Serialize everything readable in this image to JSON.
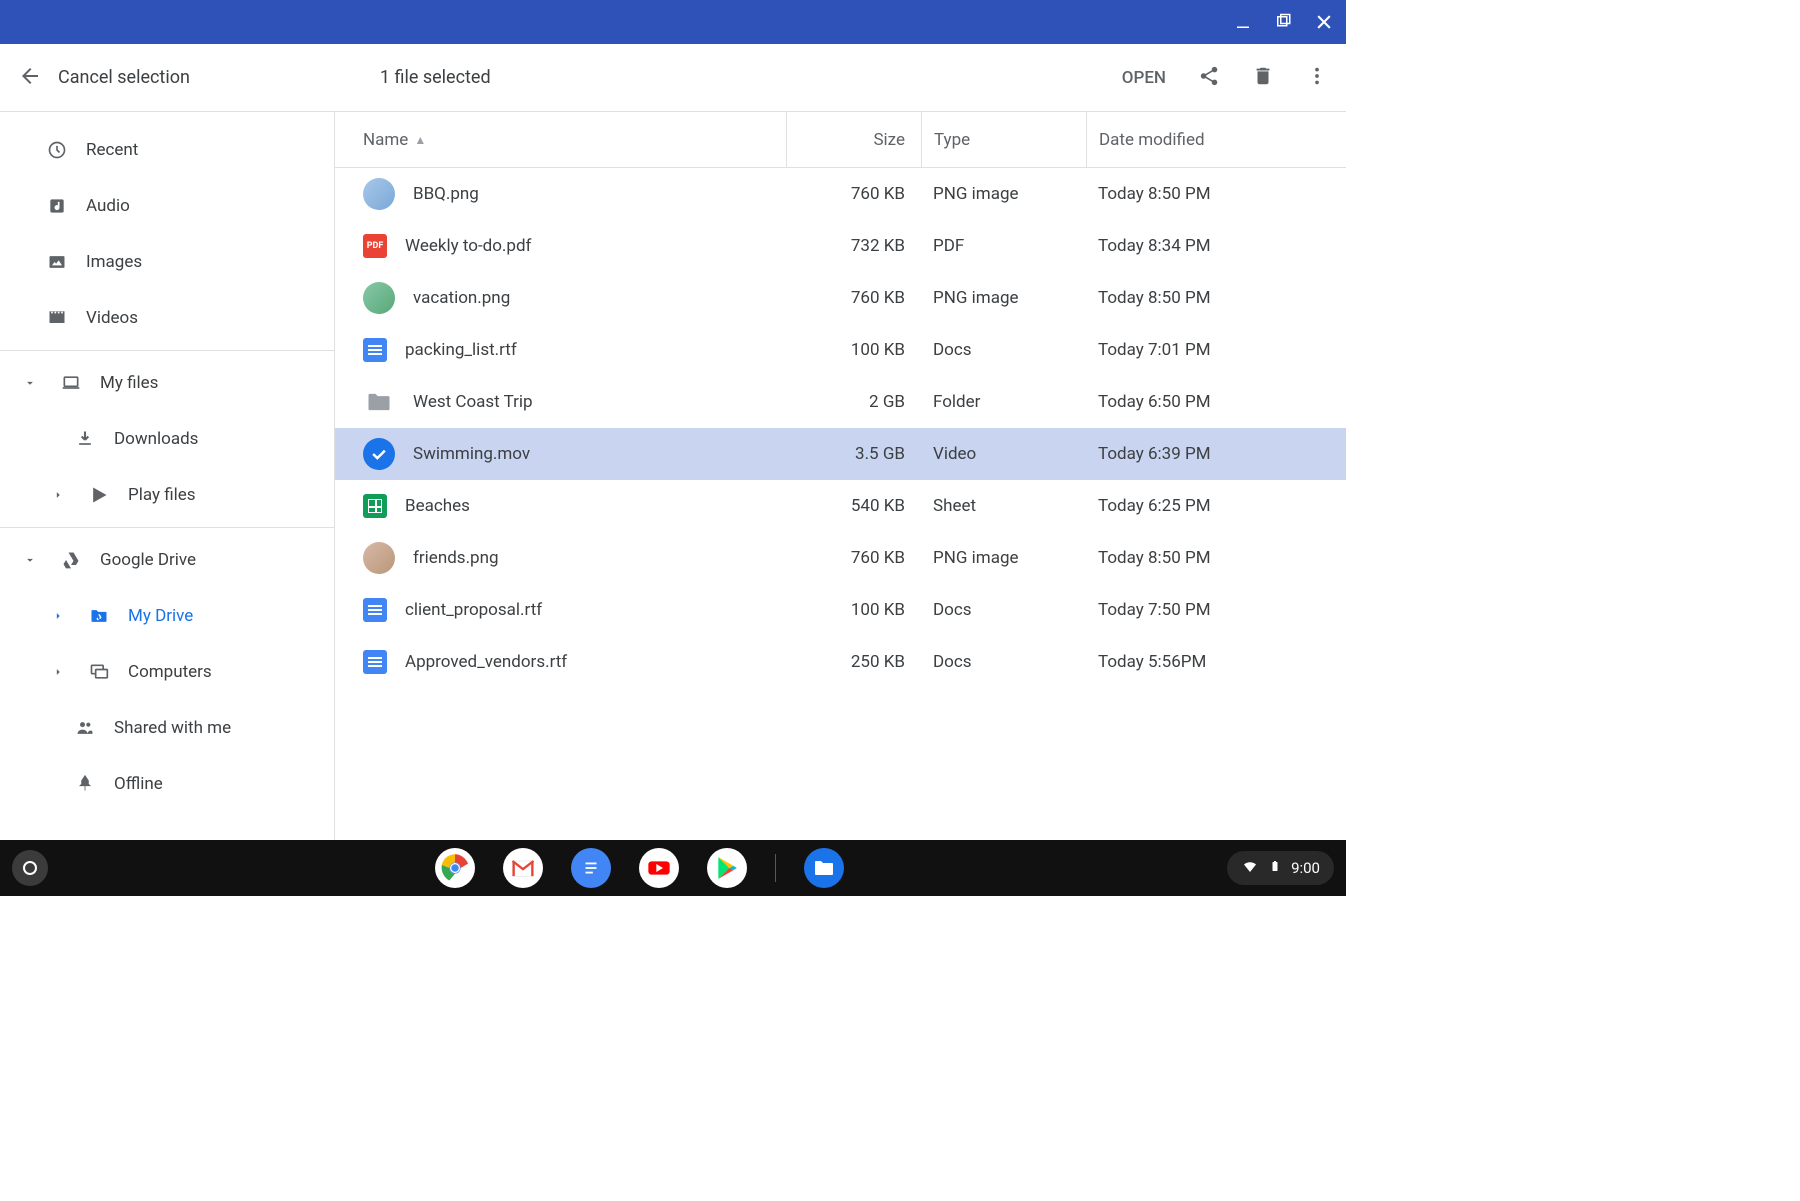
{
  "toolbar": {
    "cancel_label": "Cancel selection",
    "selection_text": "1 file selected",
    "open_label": "OPEN"
  },
  "sidebar": {
    "items": [
      {
        "label": "Recent",
        "icon": "clock"
      },
      {
        "label": "Audio",
        "icon": "audio"
      },
      {
        "label": "Images",
        "icon": "image"
      },
      {
        "label": "Videos",
        "icon": "video"
      }
    ],
    "myfiles": {
      "label": "My files",
      "children": [
        {
          "label": "Downloads",
          "icon": "download"
        },
        {
          "label": "Play files",
          "icon": "play",
          "expandable": true
        }
      ]
    },
    "drive": {
      "label": "Google Drive",
      "children": [
        {
          "label": "My Drive",
          "icon": "drive-folder",
          "active": true,
          "expandable": true
        },
        {
          "label": "Computers",
          "icon": "computers",
          "expandable": true
        },
        {
          "label": "Shared with me",
          "icon": "shared"
        },
        {
          "label": "Offline",
          "icon": "offline"
        }
      ]
    }
  },
  "columns": {
    "name": "Name",
    "size": "Size",
    "type": "Type",
    "date": "Date modified"
  },
  "files": [
    {
      "name": "BBQ.png",
      "size": "760 KB",
      "type": "PNG image",
      "date": "Today 8:50 PM",
      "icon": "thumb"
    },
    {
      "name": "Weekly to-do.pdf",
      "size": "732 KB",
      "type": "PDF",
      "date": "Today 8:34 PM",
      "icon": "pdf"
    },
    {
      "name": "vacation.png",
      "size": "760 KB",
      "type": "PNG image",
      "date": "Today 8:50 PM",
      "icon": "thumb2"
    },
    {
      "name": "packing_list.rtf",
      "size": "100 KB",
      "type": "Docs",
      "date": "Today 7:01 PM",
      "icon": "docs"
    },
    {
      "name": "West Coast Trip",
      "size": "2 GB",
      "type": "Folder",
      "date": "Today 6:50 PM",
      "icon": "folder"
    },
    {
      "name": "Swimming.mov",
      "size": "3.5 GB",
      "type": "Video",
      "date": "Today 6:39 PM",
      "icon": "check",
      "selected": true
    },
    {
      "name": "Beaches",
      "size": "540 KB",
      "type": "Sheet",
      "date": "Today 6:25 PM",
      "icon": "sheet"
    },
    {
      "name": "friends.png",
      "size": "760 KB",
      "type": "PNG image",
      "date": "Today 8:50 PM",
      "icon": "thumb3"
    },
    {
      "name": "client_proposal.rtf",
      "size": "100 KB",
      "type": "Docs",
      "date": "Today 7:50 PM",
      "icon": "docs"
    },
    {
      "name": "Approved_vendors.rtf",
      "size": "250 KB",
      "type": "Docs",
      "date": "Today 5:56PM",
      "icon": "docs"
    }
  ],
  "shelf": {
    "time": "9:00"
  }
}
